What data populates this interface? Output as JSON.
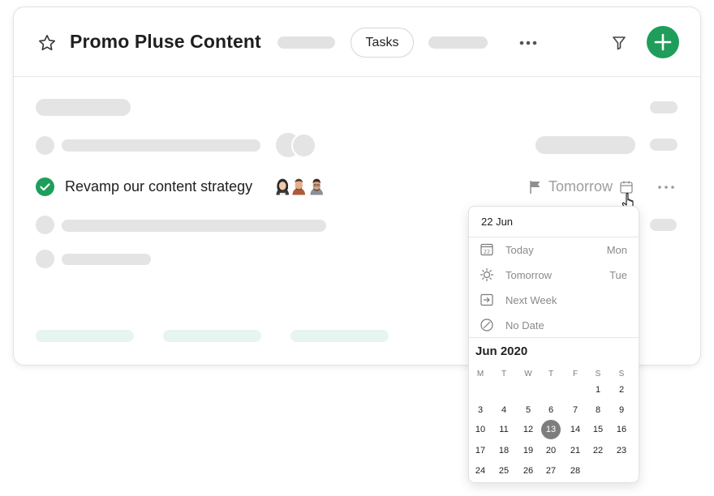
{
  "project": {
    "title": "Promo Pluse Content"
  },
  "header": {
    "tab_label": "Tasks",
    "accent": "#1e9e5a"
  },
  "task": {
    "title": "Revamp our content strategy",
    "completed": true,
    "due_label": "Tomorrow",
    "assignee_count": 3
  },
  "date_picker": {
    "input_value": "22 Jun",
    "options": [
      {
        "label": "Today",
        "day": "Mon",
        "icon": "calendar-today-icon"
      },
      {
        "label": "Tomorrow",
        "day": "Tue",
        "icon": "sun-icon"
      },
      {
        "label": "Next Week",
        "day": "",
        "icon": "next-week-icon"
      },
      {
        "label": "No Date",
        "day": "",
        "icon": "no-date-icon"
      }
    ],
    "month_label": "Jun 2020",
    "weekdays": [
      "M",
      "T",
      "W",
      "T",
      "F",
      "S",
      "S"
    ],
    "weeks": [
      [
        "",
        "",
        "",
        "",
        "",
        "1",
        "2"
      ],
      [
        "3",
        "4",
        "5",
        "6",
        "7",
        "8",
        "9"
      ],
      [
        "10",
        "11",
        "12",
        "13",
        "14",
        "15",
        "16"
      ],
      [
        "17",
        "18",
        "19",
        "20",
        "21",
        "22",
        "23"
      ],
      [
        "24",
        "25",
        "26",
        "27",
        "28",
        "",
        ""
      ]
    ],
    "selected_day": "13"
  }
}
